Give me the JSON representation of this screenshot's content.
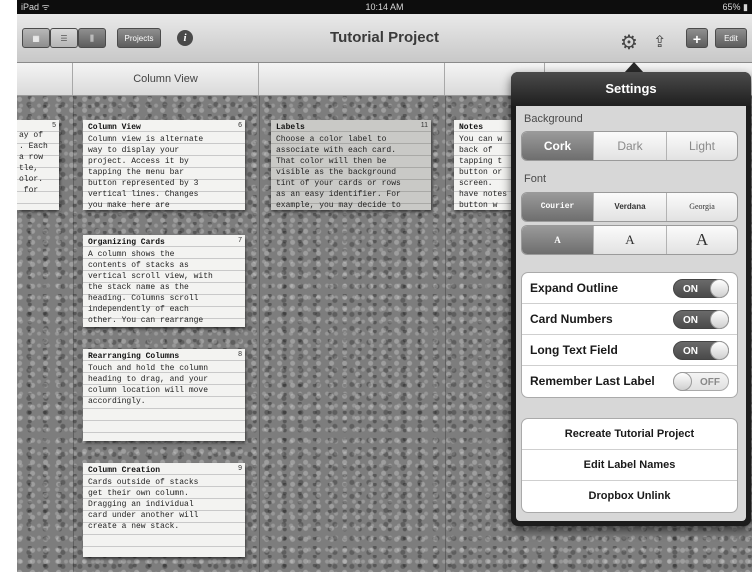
{
  "status_bar": {
    "carrier": "iPad ᯤ",
    "time": "10:14 AM",
    "battery": "65% ▮"
  },
  "nav": {
    "title": "Tutorial Project",
    "projects_label": "Projects",
    "info_label": "i",
    "add_label": "+",
    "edit_label": "Edit",
    "icons": [
      "grid-view-icon",
      "list-view-icon",
      "column-view-icon",
      "info-icon",
      "gear-icon",
      "share-icon",
      "add-icon"
    ]
  },
  "column_headers": [
    "",
    "Column View",
    "",
    ""
  ],
  "cards": [
    {
      "title": "",
      "num": "5",
      "body": "ay of\n. Each\na row\ntle,\nolor.\n for"
    },
    {
      "title": "Column View",
      "num": "6",
      "body": "Column view is alternate\nway to display your\nproject. Access it by\ntapping the menu bar\nbutton represented by 3\nvertical lines. Changes\nyou make here are"
    },
    {
      "title": "Organizing Cards",
      "num": "7",
      "body": "A column shows the\ncontents of stacks as\nvertical scroll view, with\nthe stack name as the\nheading. Columns scroll\nindependently of each\nother. You can rearrange"
    },
    {
      "title": "Rearranging Columns",
      "num": "8",
      "body": "Touch and hold the column\nheading to drag, and your\ncolumn location will move\naccordingly."
    },
    {
      "title": "Column Creation",
      "num": "9",
      "body": "Cards outside of stacks\nget their own column.\nDragging an individual\ncard under another will\ncreate a new stack."
    },
    {
      "title": "Labels",
      "num": "11",
      "body": "Choose a color label to\nassociate with each card.\nThat color will then be\nvisible as the background\ntint of your cards or rows\nas an easy identifier. For\nexample, you may decide to"
    },
    {
      "title": "Notes",
      "num": "",
      "body": "You can w\nback of\ntapping t\nbutton or\nscreen. \nhave notes\nbutton w"
    }
  ],
  "settings": {
    "title": "Settings",
    "background_label": "Background",
    "background_options": [
      "Cork",
      "Dark",
      "Light"
    ],
    "background_selected": "Cork",
    "font_label": "Font",
    "font_options": [
      "Courier",
      "Verdana",
      "Georgia"
    ],
    "font_selected": "Courier",
    "size_options": [
      "A",
      "A",
      "A"
    ],
    "size_selected_index": 0,
    "toggles": [
      {
        "label": "Expand Outline",
        "state": "ON"
      },
      {
        "label": "Card Numbers",
        "state": "ON"
      },
      {
        "label": "Long Text Field",
        "state": "ON"
      },
      {
        "label": "Remember Last Label",
        "state": "OFF"
      }
    ],
    "actions": [
      "Recreate Tutorial Project",
      "Edit Label Names",
      "Dropbox Unlink"
    ]
  },
  "colors": {
    "accent_dark": "#1c1c1c",
    "selected_segment": "#7e7e7e",
    "popover_bg": "#d7d7d7"
  }
}
